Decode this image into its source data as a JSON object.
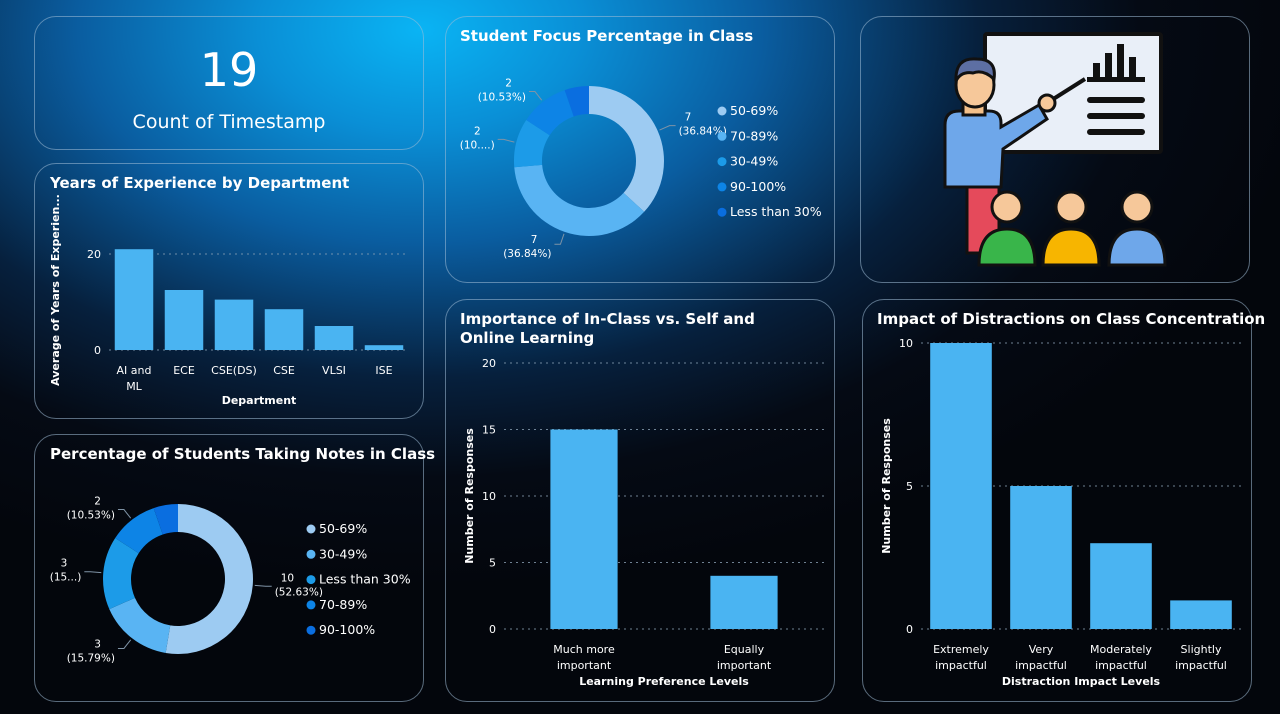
{
  "kpi": {
    "value": "19",
    "label": "Count of Timestamp"
  },
  "focus_title": "Student Focus Percentage in Class",
  "years_title": "Years of Experience by Department",
  "notes_title": "Percentage of Students Taking Notes in Class",
  "importance_title": "Importance of In-Class vs. Self and Online Learning",
  "distraction_title": "Impact of Distractions on Class Concentration",
  "chart_data": [
    {
      "type": "pie",
      "title": "Student Focus Percentage in Class",
      "legend_position": "right",
      "slices": [
        {
          "label": "50-69%",
          "value": 7,
          "pct": "36.84%",
          "color": "#9dcbf2",
          "dl1": "7",
          "dl2": "(36.84%)"
        },
        {
          "label": "70-89%",
          "value": 7,
          "pct": "36.84%",
          "color": "#59b4f3",
          "dl1": "7",
          "dl2": "(36.84%)"
        },
        {
          "label": "30-49%",
          "value": 2,
          "pct": "10.53%",
          "color": "#1c9be8",
          "dl1": "2",
          "dl2": "(10....)"
        },
        {
          "label": "90-100%",
          "value": 2,
          "pct": "10.53%",
          "color": "#0d84e6",
          "dl1": "2",
          "dl2": "(10.53%)"
        },
        {
          "label": "Less than 30%",
          "value": 1,
          "pct": "5.26%",
          "color": "#0a6ee0",
          "dl1": "",
          "dl2": ""
        }
      ]
    },
    {
      "type": "bar",
      "title": "Years of Experience by Department",
      "xlabel": "Department",
      "ylabel": "Average of Years of Experien...",
      "categories": [
        "AI and ML",
        "ECE",
        "CSE(DS)",
        "CSE",
        "VLSI",
        "ISE"
      ],
      "values": [
        21,
        12.5,
        10.5,
        8.5,
        5,
        1
      ],
      "ylim": [
        0,
        25
      ],
      "yticks": [
        0,
        20
      ],
      "grid": true
    },
    {
      "type": "pie",
      "title": "Percentage of Students Taking Notes in Class",
      "legend_position": "right",
      "slices": [
        {
          "label": "50-69%",
          "value": 10,
          "pct": "52.63%",
          "color": "#9dcbf2",
          "dl1": "10",
          "dl2": "(52.63%)"
        },
        {
          "label": "30-49%",
          "value": 3,
          "pct": "15.79%",
          "color": "#59b4f3",
          "dl1": "3",
          "dl2": "(15.79%)"
        },
        {
          "label": "Less than 30%",
          "value": 3,
          "pct": "15.79%",
          "color": "#1c9be8",
          "dl1": "3",
          "dl2": "(15...)"
        },
        {
          "label": "70-89%",
          "value": 2,
          "pct": "10.53%",
          "color": "#0d84e6",
          "dl1": "2",
          "dl2": "(10.53%)"
        },
        {
          "label": "90-100%",
          "value": 1,
          "pct": "5.26%",
          "color": "#0a6ee0",
          "dl1": "",
          "dl2": ""
        }
      ]
    },
    {
      "type": "bar",
      "title": "Importance of In-Class vs. Self and Online Learning",
      "xlabel": "Learning Preference Levels",
      "ylabel": "Number of Responses",
      "categories": [
        "Much more important",
        "Equally important"
      ],
      "values": [
        15,
        4
      ],
      "ylim": [
        0,
        20
      ],
      "yticks": [
        0,
        5,
        10,
        15,
        20
      ],
      "grid": true
    },
    {
      "type": "bar",
      "title": "Impact of Distractions on Class Concentration",
      "xlabel": "Distraction Impact Levels",
      "ylabel": "Number of Responses",
      "categories": [
        "Extremely impactful",
        "Very impactful",
        "Moderately impactful",
        "Slightly impactful"
      ],
      "values": [
        10,
        5,
        3,
        1
      ],
      "ylim": [
        0,
        10
      ],
      "yticks": [
        0,
        5,
        10
      ],
      "grid": true
    }
  ],
  "colors": {
    "bar": "#4ab4f2",
    "border": "#a0bed7"
  },
  "illustration": {
    "name": "teacher-presentation-icon"
  }
}
